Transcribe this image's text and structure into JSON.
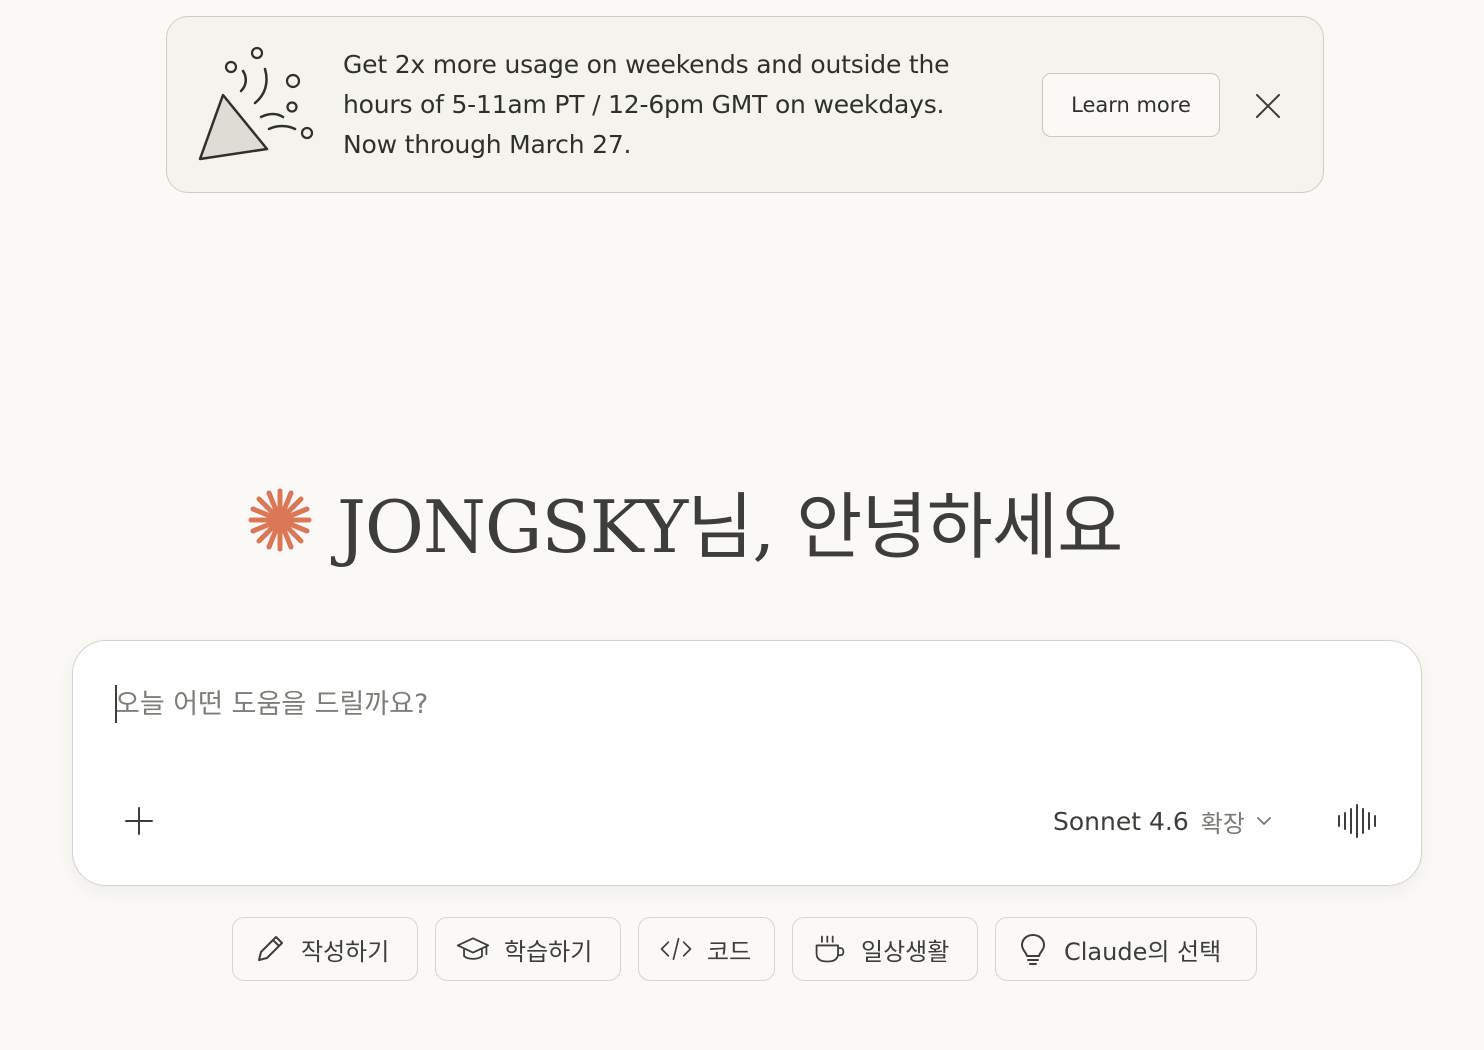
{
  "banner": {
    "lines": [
      "Get 2x more usage on weekends and outside the",
      "hours of 5-11am PT / 12-6pm GMT on weekdays.",
      "Now through March 27."
    ],
    "learn_more_label": "Learn more",
    "icon": "party-popper-icon",
    "close_icon": "close-icon"
  },
  "greeting": {
    "text": "JONGSKY님, 안녕하세요",
    "icon": "claude-spark-icon",
    "icon_color": "#d97757"
  },
  "composer": {
    "placeholder": "오늘 어떤 도움을 드릴까요?",
    "value": "",
    "model_name": "Sonnet 4.6",
    "model_mode": "확장",
    "plus_icon": "plus-icon",
    "chevron_icon": "chevron-down-icon",
    "voice_icon": "voice-waveform-icon"
  },
  "chips": [
    {
      "label": "작성하기",
      "icon": "pencil-icon"
    },
    {
      "label": "학습하기",
      "icon": "graduation-cap-icon"
    },
    {
      "label": "코드",
      "icon": "code-icon"
    },
    {
      "label": "일상생활",
      "icon": "coffee-cup-icon"
    },
    {
      "label": "Claude의 선택",
      "icon": "lightbulb-icon"
    }
  ],
  "colors": {
    "background": "#faf9f5",
    "accent": "#d97757",
    "text": "#3d3d3a"
  }
}
